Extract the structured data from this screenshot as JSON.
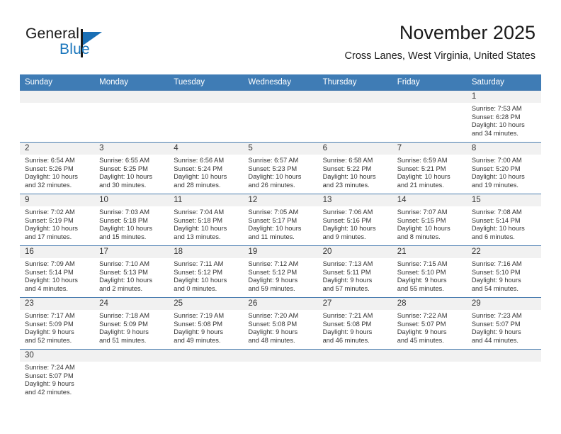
{
  "brand": {
    "word_one": "General",
    "word_two": "Blue",
    "flag_icon": "general-blue-flag-logo",
    "accent_color": "#1a76bc"
  },
  "header": {
    "month_title": "November 2025",
    "location": "Cross Lanes, West Virginia, United States"
  },
  "calendar": {
    "header_background": "#3f7cb5",
    "daynum_background": "#f1f1f1",
    "grid_line_color": "#4a7db0",
    "weekdays": [
      "Sunday",
      "Monday",
      "Tuesday",
      "Wednesday",
      "Thursday",
      "Friday",
      "Saturday"
    ],
    "weeks": [
      [
        {
          "day": "",
          "empty": true
        },
        {
          "day": "",
          "empty": true
        },
        {
          "day": "",
          "empty": true
        },
        {
          "day": "",
          "empty": true
        },
        {
          "day": "",
          "empty": true
        },
        {
          "day": "",
          "empty": true
        },
        {
          "day": "1",
          "sunrise": "Sunrise: 7:53 AM",
          "sunset": "Sunset: 6:28 PM",
          "daylight_1": "Daylight: 10 hours",
          "daylight_2": "and 34 minutes."
        }
      ],
      [
        {
          "day": "2",
          "sunrise": "Sunrise: 6:54 AM",
          "sunset": "Sunset: 5:26 PM",
          "daylight_1": "Daylight: 10 hours",
          "daylight_2": "and 32 minutes."
        },
        {
          "day": "3",
          "sunrise": "Sunrise: 6:55 AM",
          "sunset": "Sunset: 5:25 PM",
          "daylight_1": "Daylight: 10 hours",
          "daylight_2": "and 30 minutes."
        },
        {
          "day": "4",
          "sunrise": "Sunrise: 6:56 AM",
          "sunset": "Sunset: 5:24 PM",
          "daylight_1": "Daylight: 10 hours",
          "daylight_2": "and 28 minutes."
        },
        {
          "day": "5",
          "sunrise": "Sunrise: 6:57 AM",
          "sunset": "Sunset: 5:23 PM",
          "daylight_1": "Daylight: 10 hours",
          "daylight_2": "and 26 minutes."
        },
        {
          "day": "6",
          "sunrise": "Sunrise: 6:58 AM",
          "sunset": "Sunset: 5:22 PM",
          "daylight_1": "Daylight: 10 hours",
          "daylight_2": "and 23 minutes."
        },
        {
          "day": "7",
          "sunrise": "Sunrise: 6:59 AM",
          "sunset": "Sunset: 5:21 PM",
          "daylight_1": "Daylight: 10 hours",
          "daylight_2": "and 21 minutes."
        },
        {
          "day": "8",
          "sunrise": "Sunrise: 7:00 AM",
          "sunset": "Sunset: 5:20 PM",
          "daylight_1": "Daylight: 10 hours",
          "daylight_2": "and 19 minutes."
        }
      ],
      [
        {
          "day": "9",
          "sunrise": "Sunrise: 7:02 AM",
          "sunset": "Sunset: 5:19 PM",
          "daylight_1": "Daylight: 10 hours",
          "daylight_2": "and 17 minutes."
        },
        {
          "day": "10",
          "sunrise": "Sunrise: 7:03 AM",
          "sunset": "Sunset: 5:18 PM",
          "daylight_1": "Daylight: 10 hours",
          "daylight_2": "and 15 minutes."
        },
        {
          "day": "11",
          "sunrise": "Sunrise: 7:04 AM",
          "sunset": "Sunset: 5:18 PM",
          "daylight_1": "Daylight: 10 hours",
          "daylight_2": "and 13 minutes."
        },
        {
          "day": "12",
          "sunrise": "Sunrise: 7:05 AM",
          "sunset": "Sunset: 5:17 PM",
          "daylight_1": "Daylight: 10 hours",
          "daylight_2": "and 11 minutes."
        },
        {
          "day": "13",
          "sunrise": "Sunrise: 7:06 AM",
          "sunset": "Sunset: 5:16 PM",
          "daylight_1": "Daylight: 10 hours",
          "daylight_2": "and 9 minutes."
        },
        {
          "day": "14",
          "sunrise": "Sunrise: 7:07 AM",
          "sunset": "Sunset: 5:15 PM",
          "daylight_1": "Daylight: 10 hours",
          "daylight_2": "and 8 minutes."
        },
        {
          "day": "15",
          "sunrise": "Sunrise: 7:08 AM",
          "sunset": "Sunset: 5:14 PM",
          "daylight_1": "Daylight: 10 hours",
          "daylight_2": "and 6 minutes."
        }
      ],
      [
        {
          "day": "16",
          "sunrise": "Sunrise: 7:09 AM",
          "sunset": "Sunset: 5:14 PM",
          "daylight_1": "Daylight: 10 hours",
          "daylight_2": "and 4 minutes."
        },
        {
          "day": "17",
          "sunrise": "Sunrise: 7:10 AM",
          "sunset": "Sunset: 5:13 PM",
          "daylight_1": "Daylight: 10 hours",
          "daylight_2": "and 2 minutes."
        },
        {
          "day": "18",
          "sunrise": "Sunrise: 7:11 AM",
          "sunset": "Sunset: 5:12 PM",
          "daylight_1": "Daylight: 10 hours",
          "daylight_2": "and 0 minutes."
        },
        {
          "day": "19",
          "sunrise": "Sunrise: 7:12 AM",
          "sunset": "Sunset: 5:12 PM",
          "daylight_1": "Daylight: 9 hours",
          "daylight_2": "and 59 minutes."
        },
        {
          "day": "20",
          "sunrise": "Sunrise: 7:13 AM",
          "sunset": "Sunset: 5:11 PM",
          "daylight_1": "Daylight: 9 hours",
          "daylight_2": "and 57 minutes."
        },
        {
          "day": "21",
          "sunrise": "Sunrise: 7:15 AM",
          "sunset": "Sunset: 5:10 PM",
          "daylight_1": "Daylight: 9 hours",
          "daylight_2": "and 55 minutes."
        },
        {
          "day": "22",
          "sunrise": "Sunrise: 7:16 AM",
          "sunset": "Sunset: 5:10 PM",
          "daylight_1": "Daylight: 9 hours",
          "daylight_2": "and 54 minutes."
        }
      ],
      [
        {
          "day": "23",
          "sunrise": "Sunrise: 7:17 AM",
          "sunset": "Sunset: 5:09 PM",
          "daylight_1": "Daylight: 9 hours",
          "daylight_2": "and 52 minutes."
        },
        {
          "day": "24",
          "sunrise": "Sunrise: 7:18 AM",
          "sunset": "Sunset: 5:09 PM",
          "daylight_1": "Daylight: 9 hours",
          "daylight_2": "and 51 minutes."
        },
        {
          "day": "25",
          "sunrise": "Sunrise: 7:19 AM",
          "sunset": "Sunset: 5:08 PM",
          "daylight_1": "Daylight: 9 hours",
          "daylight_2": "and 49 minutes."
        },
        {
          "day": "26",
          "sunrise": "Sunrise: 7:20 AM",
          "sunset": "Sunset: 5:08 PM",
          "daylight_1": "Daylight: 9 hours",
          "daylight_2": "and 48 minutes."
        },
        {
          "day": "27",
          "sunrise": "Sunrise: 7:21 AM",
          "sunset": "Sunset: 5:08 PM",
          "daylight_1": "Daylight: 9 hours",
          "daylight_2": "and 46 minutes."
        },
        {
          "day": "28",
          "sunrise": "Sunrise: 7:22 AM",
          "sunset": "Sunset: 5:07 PM",
          "daylight_1": "Daylight: 9 hours",
          "daylight_2": "and 45 minutes."
        },
        {
          "day": "29",
          "sunrise": "Sunrise: 7:23 AM",
          "sunset": "Sunset: 5:07 PM",
          "daylight_1": "Daylight: 9 hours",
          "daylight_2": "and 44 minutes."
        }
      ],
      [
        {
          "day": "30",
          "sunrise": "Sunrise: 7:24 AM",
          "sunset": "Sunset: 5:07 PM",
          "daylight_1": "Daylight: 9 hours",
          "daylight_2": "and 42 minutes."
        },
        {
          "day": "",
          "empty": true
        },
        {
          "day": "",
          "empty": true
        },
        {
          "day": "",
          "empty": true
        },
        {
          "day": "",
          "empty": true
        },
        {
          "day": "",
          "empty": true
        },
        {
          "day": "",
          "empty": true
        }
      ]
    ]
  }
}
